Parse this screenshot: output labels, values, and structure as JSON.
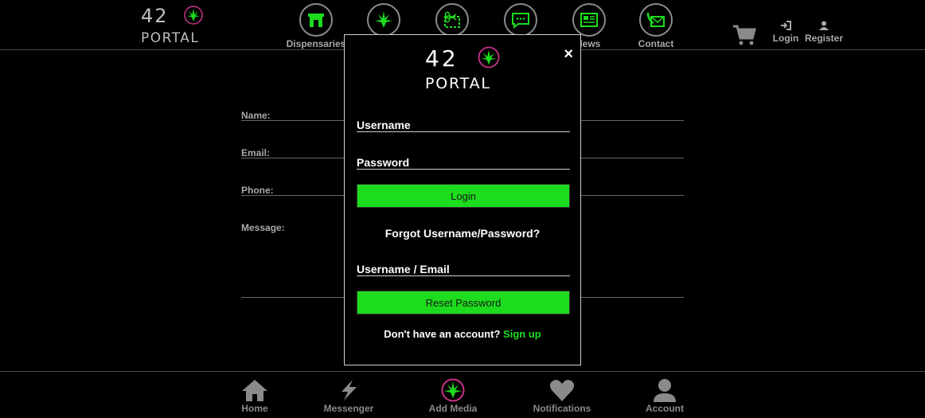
{
  "brand": {
    "line1": "42",
    "line2": "PORTAL",
    "leaf_color": "#1ddc1d",
    "ring_color": "#c8338a"
  },
  "nav": {
    "items": [
      {
        "label": "Dispensaries",
        "icon": "storefront-icon"
      },
      {
        "label": "",
        "icon": "cannabis-leaf-icon"
      },
      {
        "label": "",
        "icon": "coupon-scissors-icon"
      },
      {
        "label": "",
        "icon": "chat-bubble-icon"
      },
      {
        "label": "News",
        "icon": "newspaper-icon"
      },
      {
        "label": "Contact",
        "icon": "phone-envelope-icon"
      }
    ],
    "cart_icon": "cart-icon",
    "login_label": "Login",
    "register_label": "Register"
  },
  "contact_form": {
    "name_label": "Name:",
    "email_label": "Email:",
    "phone_label": "Phone:",
    "message_label": "Message:"
  },
  "modal": {
    "username_label": "Username",
    "password_label": "Password",
    "login_button": "Login",
    "forgot_text": "Forgot Username/Password?",
    "reset_field_label": "Username / Email",
    "reset_button": "Reset Password",
    "no_account_text": "Don't have an account?",
    "signup_link": "Sign up",
    "close_symbol": "×"
  },
  "bottom_nav": {
    "items": [
      {
        "label": "Home",
        "icon": "home-icon"
      },
      {
        "label": "Messenger",
        "icon": "lightning-icon"
      },
      {
        "label": "Add Media",
        "icon": "cannabis-leaf-icon"
      },
      {
        "label": "Notifications",
        "icon": "heart-icon"
      },
      {
        "label": "Account",
        "icon": "user-icon"
      }
    ]
  },
  "colors": {
    "accent_green": "#1ddc1d",
    "muted_text": "#a8a8a8",
    "background": "#000000"
  }
}
